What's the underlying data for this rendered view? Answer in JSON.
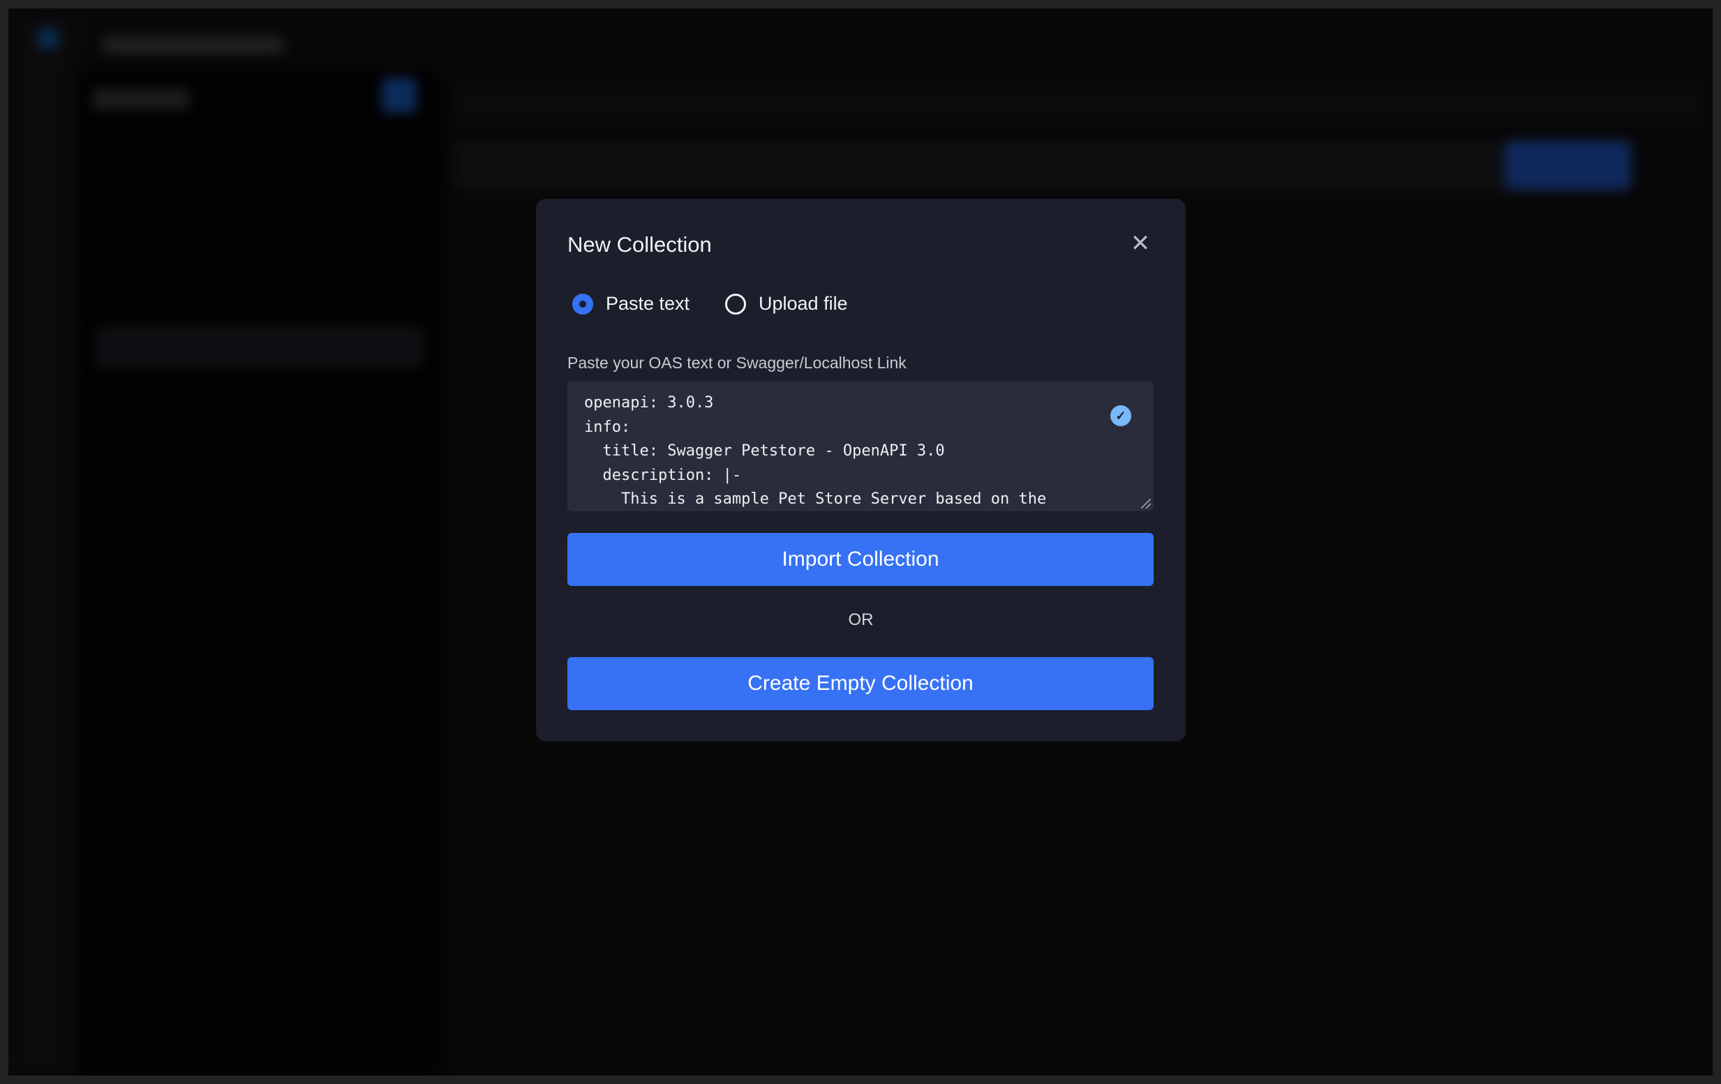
{
  "modal": {
    "title": "New Collection",
    "close_icon": "close-icon",
    "options": [
      {
        "label": "Paste text",
        "selected": true
      },
      {
        "label": "Upload file",
        "selected": false
      }
    ],
    "input_label": "Paste your OAS text or Swagger/Localhost Link",
    "textarea_value": "openapi: 3.0.3\ninfo:\n  title: Swagger Petstore - OpenAPI 3.0\n  description: |-\n    This is a sample Pet Store Server based on the",
    "valid_icon": "check-circle-icon",
    "import_label": "Import Collection",
    "or_label": "OR",
    "create_label": "Create Empty Collection"
  },
  "colors": {
    "accent": "#3772f5",
    "modal_bg": "#1c1e2b",
    "input_bg": "#2a2c3b",
    "valid": "#7ab8f7"
  }
}
